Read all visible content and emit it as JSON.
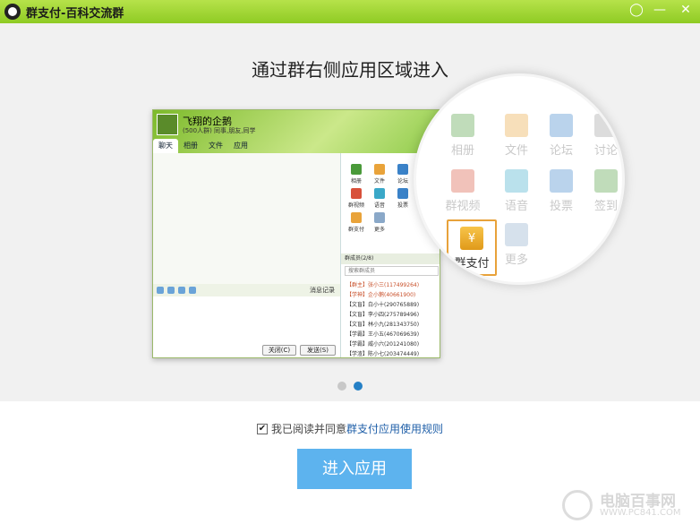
{
  "window": {
    "title": "群支付-百科交流群",
    "controls": [
      "◯",
      "—",
      "✕"
    ]
  },
  "carousel": {
    "headline": "通过群右侧应用区域进入",
    "mini_window": {
      "group_name": "飞翔的企鹅",
      "group_sub": "(500人群) 同事,朋友,同学",
      "tabs": [
        "聊天",
        "相册",
        "文件",
        "应用"
      ],
      "apps": [
        {
          "label": "相册",
          "color": "#4a9a3a"
        },
        {
          "label": "文件",
          "color": "#e9a33a"
        },
        {
          "label": "论坛",
          "color": "#3a82c8"
        },
        {
          "label": "群视频",
          "color": "#d8503a"
        },
        {
          "label": "语音",
          "color": "#3aa8c8"
        },
        {
          "label": "投票",
          "color": "#3a82c8"
        },
        {
          "label": "群支付",
          "color": "#e9a33a"
        },
        {
          "label": "更多",
          "color": "#8aa8c8"
        }
      ],
      "toolbar_text": "消息记录",
      "members_header": "群成员(2/8)",
      "search_placeholder": "搜索群成员",
      "members": [
        "【群主】张小三(117499264)",
        "【学神】企小鹅(40661900)",
        "【文盲】白小十(290765889)",
        "【文盲】李小四(275789496)",
        "【文盲】林小九(281343750)",
        "【学霸】王小五(467069639)",
        "【学霸】威小六(201241080)",
        "【学渣】陈小七(203474449)"
      ],
      "close_label": "关闭(C)",
      "send_label": "发送(S)"
    },
    "magnifier": {
      "apps": [
        {
          "label": "相册",
          "color": "#4a9a3a"
        },
        {
          "label": "文件",
          "color": "#e9a33a"
        },
        {
          "label": "论坛",
          "color": "#3a82c8"
        },
        {
          "label": "讨论",
          "color": "#9a9a9a"
        },
        {
          "label": "群视频",
          "color": "#d8503a"
        },
        {
          "label": "语音",
          "color": "#3aa8c8"
        },
        {
          "label": "投票",
          "color": "#3a82c8"
        },
        {
          "label": "签到",
          "color": "#4a9a3a"
        },
        {
          "label": "群支付",
          "color": "#e9a33a"
        },
        {
          "label": "更多",
          "color": "#8aa8c8"
        }
      ],
      "pay_symbol": "¥"
    },
    "pages": 2,
    "active_page": 2
  },
  "agreement": {
    "checked": true,
    "checkmark": "✔",
    "text": "我已阅读并同意",
    "link": "群支付应用使用规则"
  },
  "enter_button": "进入应用",
  "watermark": {
    "text": "电脑百事网",
    "url": "WWW.PC841.COM"
  },
  "colors": {
    "titlebar": "#9dd436",
    "accent": "#5db3ee",
    "link": "#1f5fa8",
    "highlight_border": "#e8a23a"
  }
}
